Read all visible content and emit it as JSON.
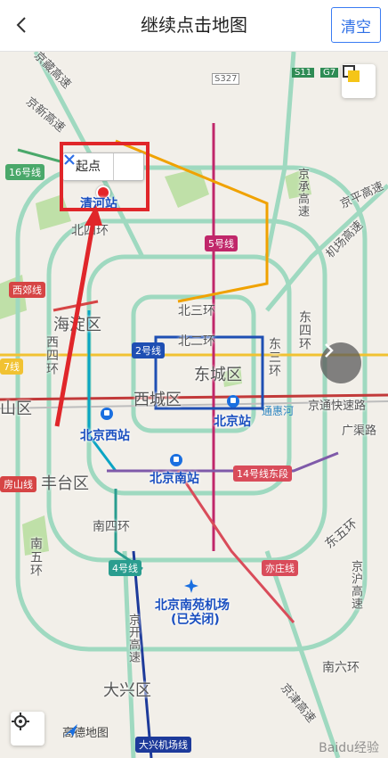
{
  "header": {
    "title": "继续点击地图",
    "clear_label": "清空"
  },
  "popup": {
    "label": "起点",
    "station": "清河站"
  },
  "districts": {
    "haidian": "海淀区",
    "dongcheng": "东城区",
    "xicheng": "西城区",
    "fengtai": "丰台区",
    "daxing": "大兴区",
    "chao": "山区"
  },
  "rings": {
    "north4": "北四环",
    "north3": "北三环",
    "north2": "北二环",
    "west4": "西四环",
    "west3": "西三环",
    "east4": "东四环",
    "east3": "东三环",
    "south4": "南四环",
    "south5": "南五环",
    "south6": "南六环",
    "east5": "东五环",
    "north5": "北五环"
  },
  "roads": {
    "jingzang": "京藏高速",
    "jingxin": "京新高速",
    "jingcheng": "京承高速",
    "jingping": "京平高速",
    "airport": "机场高速",
    "jingtong": "京通快速路",
    "guangqu": "广渠路",
    "jinghu": "京沪高速",
    "jingkai": "京开高速",
    "jingjin": "京津高速",
    "s327": "S327",
    "g7": "G7",
    "s11": "S11"
  },
  "stations": {
    "bjw": "北京西站",
    "bj": "北京站",
    "bjs": "北京南站",
    "nanyuan": "北京南苑机场",
    "closed": "(已关闭)"
  },
  "lines": {
    "l16": "16号线",
    "l5": "5号线",
    "l2": "2号线",
    "xijiao": "西郊线",
    "l4": "4号线",
    "l14": "14号线东段",
    "yizhuang": "亦庄线",
    "daxing_airport": "大兴机场线",
    "l7": "7线",
    "fangshan": "房山线"
  },
  "misc": {
    "tonghui": "通惠河",
    "logo": "高德地图",
    "watermark": "Baidu经验"
  },
  "colors": {
    "accent": "#2e6fe6",
    "highlight": "#e0262a"
  }
}
